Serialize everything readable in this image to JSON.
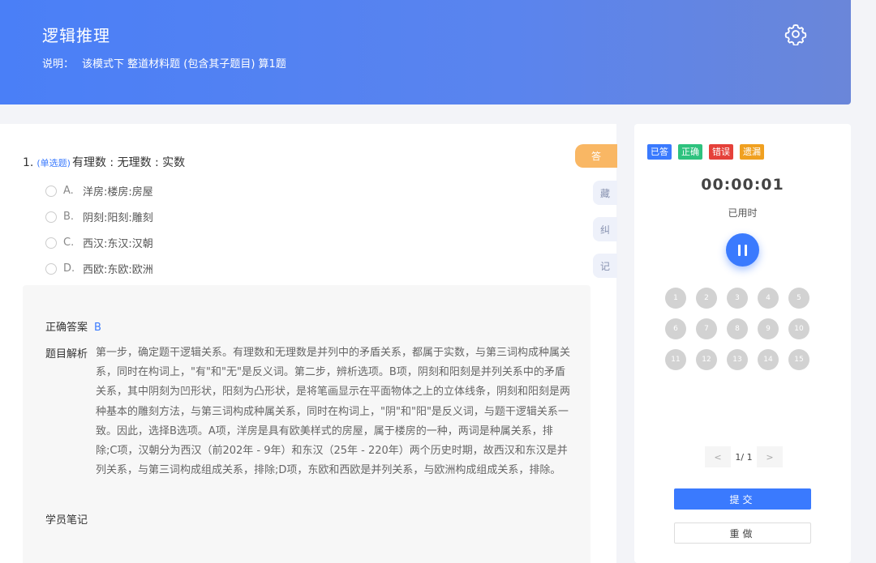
{
  "header": {
    "title": "逻辑推理",
    "desc_label": "说明：",
    "desc_text": "该模式下 整道材料题 (包含其子题目) 算1题"
  },
  "question": {
    "number": "1.",
    "type": "(单选题)",
    "stem": "有理数 : 无理数 : 实数",
    "options": [
      {
        "letter": "A.",
        "text": "洋房:楼房:房屋"
      },
      {
        "letter": "B.",
        "text": "阴刻:阳刻:雕刻"
      },
      {
        "letter": "C.",
        "text": "西汉:东汉:汉朝"
      },
      {
        "letter": "D.",
        "text": "西欧:东欧:欧洲"
      }
    ]
  },
  "analysis": {
    "answer_label": "正确答案",
    "answer_value": "B",
    "explanation_label": "题目解析",
    "explanation": "第一步，确定题干逻辑关系。有理数和无理数是并列中的矛盾关系，都属于实数，与第三词构成种属关系，同时在构词上，\"有\"和\"无\"是反义词。第二步，辨析选项。B项，阴刻和阳刻是并列关系中的矛盾关系，其中阴刻为凹形状，阳刻为凸形状，是将笔画显示在平面物体之上的立体线条，阴刻和阳刻是两种基本的雕刻方法，与第三词构成种属关系，同时在构词上，\"阴\"和\"阳\"是反义词，与题干逻辑关系一致。因此，选择B选项。A项，洋房是具有欧美样式的房屋，属于楼房的一种，两词是种属关系，排除;C项，汉朝分为西汉（前202年 - 9年）和东汉（25年 - 220年）两个历史时期，故西汉和东汉是并列关系，与第三词构成组成关系，排除;D项，东欧和西欧是并列关系，与欧洲构成组成关系，排除。",
    "notes_label": "学员笔记"
  },
  "side_tabs": {
    "answer": "答",
    "collect": "藏",
    "correct": "纠",
    "note": "记"
  },
  "panel": {
    "legend": [
      {
        "label": "已答",
        "color": "#3a7afe"
      },
      {
        "label": "正确",
        "color": "#2ec27e"
      },
      {
        "label": "错误",
        "color": "#e5413a"
      },
      {
        "label": "遗漏",
        "color": "#f0a020"
      }
    ],
    "timer": "00:00:01",
    "timer_label": "已用时",
    "question_numbers": [
      "1",
      "2",
      "3",
      "4",
      "5",
      "6",
      "7",
      "8",
      "9",
      "10",
      "11",
      "12",
      "13",
      "14",
      "15"
    ],
    "pager_text": "1/ 1",
    "prev": "<",
    "next": ">",
    "submit": "提交",
    "redo": "重做"
  }
}
